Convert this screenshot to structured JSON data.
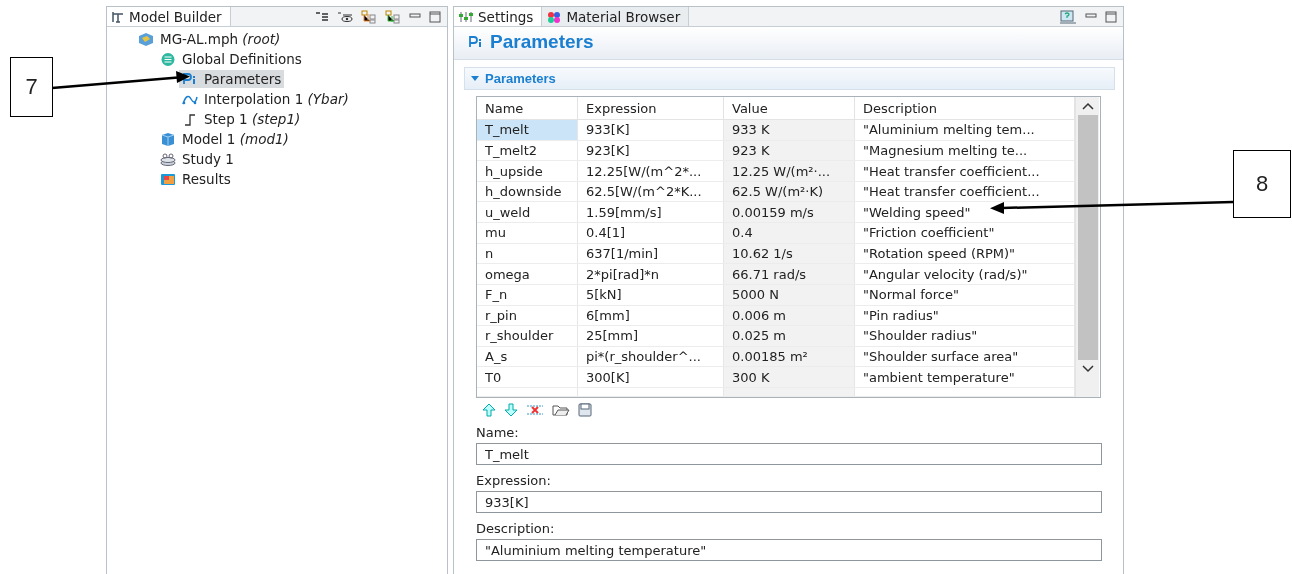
{
  "model_builder": {
    "title": "Model Builder",
    "tree": [
      {
        "label": "MG-AL.mph *(root)*",
        "selected": false,
        "children": [
          {
            "label": "Global Definitions",
            "selected": false,
            "children": [
              {
                "label": "Parameters",
                "selected": true
              },
              {
                "label": "Interpolation 1 *(Ybar)*",
                "selected": false
              },
              {
                "label": "Step 1 *(step1)*",
                "selected": false
              }
            ]
          },
          {
            "label": "Model 1 *(mod1)*",
            "selected": false
          },
          {
            "label": "Study 1",
            "selected": false
          },
          {
            "label": "Results",
            "selected": false
          }
        ]
      }
    ]
  },
  "tabs": [
    {
      "label": "Settings",
      "selected": true
    },
    {
      "label": "Material Browser",
      "selected": false
    }
  ],
  "settings": {
    "title": "Parameters",
    "section": {
      "title": "Parameters",
      "expanded": true
    },
    "table": {
      "columns": [
        "Name",
        "Expression",
        "Value",
        "Description"
      ],
      "rows": [
        {
          "cells": [
            "T_melt",
            "933[K]",
            "933 K",
            "\"Aluminium melting tem..."
          ],
          "selected": true
        },
        {
          "cells": [
            "T_melt2",
            "923[K]",
            "923 K",
            "\"Magnesium melting te..."
          ],
          "selected": false
        },
        {
          "cells": [
            "h_upside",
            "12.25[W/(m^2*...",
            "12.25 W/(m²·...",
            "\"Heat transfer coefficient..."
          ],
          "selected": false
        },
        {
          "cells": [
            "h_downside",
            "62.5[W/(m^2*K...",
            "62.5 W/(m²·K)",
            "\"Heat transfer coefficient..."
          ],
          "selected": false
        },
        {
          "cells": [
            "u_weld",
            "1.59[mm/s]",
            "0.00159 m/s",
            "\"Welding speed\""
          ],
          "selected": false
        },
        {
          "cells": [
            "mu",
            "0.4[1]",
            "0.4",
            "\"Friction coefficient\""
          ],
          "selected": false
        },
        {
          "cells": [
            "n",
            "637[1/min]",
            "10.62 1/s",
            "\"Rotation speed (RPM)\""
          ],
          "selected": false
        },
        {
          "cells": [
            "omega",
            "2*pi[rad]*n",
            "66.71 rad/s",
            "\"Angular velocity (rad/s)\""
          ],
          "selected": false
        },
        {
          "cells": [
            "F_n",
            "5[kN]",
            "5000 N",
            "\"Normal force\""
          ],
          "selected": false
        },
        {
          "cells": [
            "r_pin",
            "6[mm]",
            "0.006 m",
            "\"Pin radius\""
          ],
          "selected": false
        },
        {
          "cells": [
            "r_shoulder",
            "25[mm]",
            "0.025 m",
            "\"Shoulder radius\""
          ],
          "selected": false
        },
        {
          "cells": [
            "A_s",
            "pi*(r_shoulder^...",
            "0.00185 m²",
            "\"Shoulder surface area\""
          ],
          "selected": false
        },
        {
          "cells": [
            "T0",
            "300[K]",
            "300 K",
            "\"ambient temperature\""
          ],
          "selected": false
        }
      ]
    },
    "fields": [
      {
        "label": "Name:",
        "value": "T_melt"
      },
      {
        "label": "Expression:",
        "value": "933[K]"
      },
      {
        "label": "Description:",
        "value": "\"Aluminium melting temperature\""
      }
    ]
  },
  "callouts": [
    "7",
    "8"
  ]
}
